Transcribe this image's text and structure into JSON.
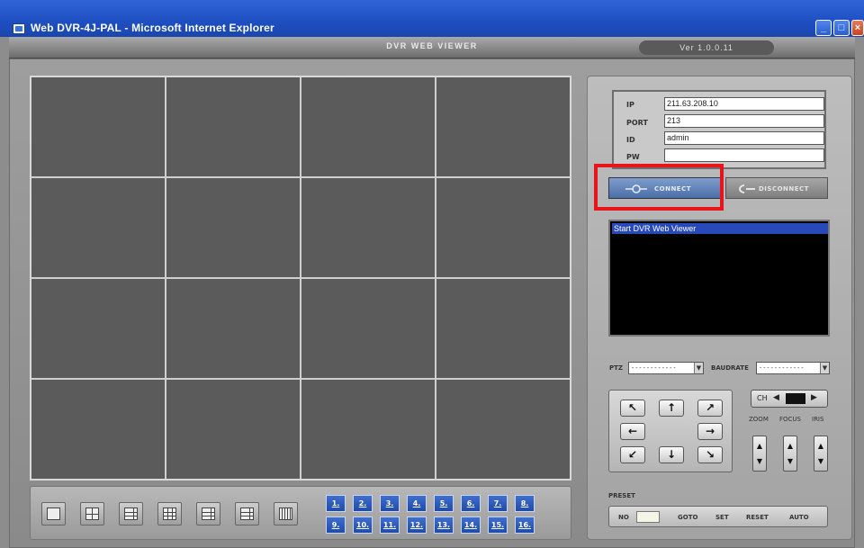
{
  "window": {
    "title": "Web DVR-4J-PAL - Microsoft Internet Explorer",
    "buttons": [
      "minimize",
      "maximize",
      "close"
    ]
  },
  "app": {
    "title": "DVR WEB VIEWER",
    "version": "Ver 1.0.0.11"
  },
  "login": {
    "labels": {
      "ip": "IP",
      "port": "PORT",
      "id": "ID",
      "pw": "PW"
    },
    "values": {
      "ip": "211.63.208.10",
      "port": "213",
      "id": "admin",
      "pw": ""
    }
  },
  "connection": {
    "connect_label": "CONNECT",
    "disconnect_label": "DISCONNECT",
    "highlight_color": "#e8141a"
  },
  "log": {
    "lines": [
      "Start DVR Web Viewer"
    ]
  },
  "ptz": {
    "ptz_label": "PTZ",
    "ptz_value": "------------",
    "baudrate_label": "BAUDRATE",
    "baudrate_value": "------------",
    "ch_label": "CH",
    "zoom_label": "ZOOM",
    "focus_label": "FOCUS",
    "iris_label": "IRIS"
  },
  "preset": {
    "title": "PRESET",
    "no_label": "NO",
    "goto_label": "GOTO",
    "set_label": "SET",
    "reset_label": "RESET",
    "auto_label": "AUTO"
  },
  "channels": [
    "1.",
    "2.",
    "3.",
    "4.",
    "5.",
    "6.",
    "7.",
    "8.",
    "9.",
    "10.",
    "11.",
    "12.",
    "13.",
    "14.",
    "15.",
    "16."
  ],
  "colors": {
    "title_bar": "#2f64d8",
    "panel_gray": "#8d8d8d",
    "video_cell": "#5b5b5b",
    "channel_button": "#2a56b5",
    "log_highlight": "#2749b9"
  }
}
